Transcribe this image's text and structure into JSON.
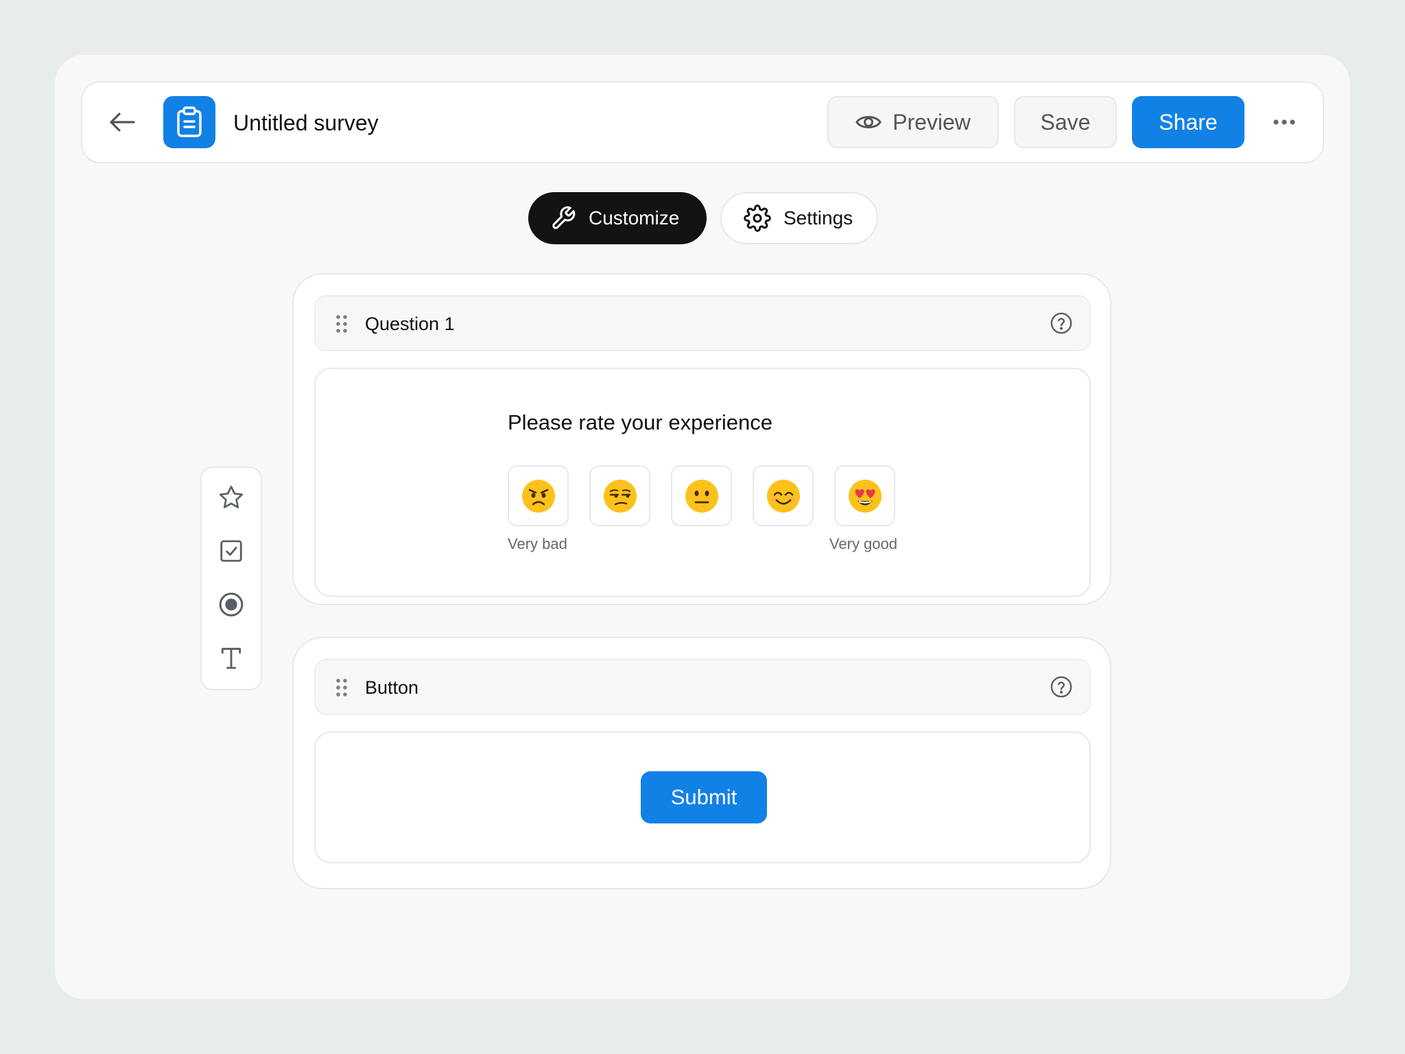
{
  "header": {
    "title": "Untitled survey",
    "preview_label": "Preview",
    "save_label": "Save",
    "share_label": "Share"
  },
  "tabs": [
    {
      "label": "Customize",
      "active": true
    },
    {
      "label": "Settings",
      "active": false
    }
  ],
  "toolbar": {
    "tools": [
      "star-icon",
      "checkbox-icon",
      "radio-icon",
      "text-icon"
    ]
  },
  "question_card": {
    "header_label": "Question 1",
    "question": "Please rate your experience",
    "emojis": [
      "😠",
      "😒",
      "😐",
      "😊",
      "😍"
    ],
    "scale_low": "Very bad",
    "scale_high": "Very good"
  },
  "button_card": {
    "header_label": "Button",
    "submit_label": "Submit"
  },
  "colors": {
    "accent": "#1281e6",
    "background": "#e9ecec",
    "surface": "#f8f8f8",
    "active_tab": "#131313"
  }
}
